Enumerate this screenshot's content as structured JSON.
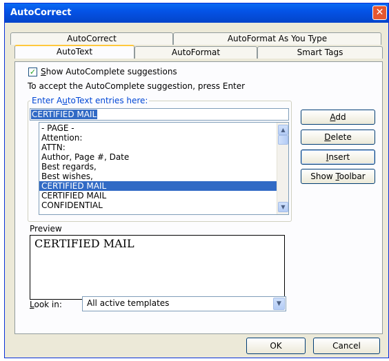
{
  "window": {
    "title": "AutoCorrect",
    "close_glyph": "✕"
  },
  "tabs_back": [
    {
      "label": "AutoCorrect"
    },
    {
      "label": "AutoFormat As You Type"
    }
  ],
  "tabs_front": [
    {
      "label": "AutoText",
      "active": true
    },
    {
      "label": "AutoFormat"
    },
    {
      "label": "Smart Tags"
    }
  ],
  "autotext": {
    "show_suggestions": {
      "pre": "",
      "accel": "S",
      "post": "how AutoComplete suggestions",
      "checked": true
    },
    "instruction": "To accept the AutoComplete suggestion, press Enter",
    "entries_legend": {
      "pre": "Enter A",
      "accel": "u",
      "post": "toText entries here:"
    },
    "entry_value": "CERTIFIED MAIL",
    "entries": [
      {
        "label": "- PAGE -"
      },
      {
        "label": "Attention:"
      },
      {
        "label": "ATTN:"
      },
      {
        "label": "Author, Page #, Date"
      },
      {
        "label": "Best regards,"
      },
      {
        "label": "Best wishes,"
      },
      {
        "label": "CERTIFIED MAIL",
        "selected": true
      },
      {
        "label": "CERTIFIED MAIL"
      },
      {
        "label": "CONFIDENTIAL"
      }
    ],
    "preview_label": "Preview",
    "preview_text": "CERTIFIED MAIL",
    "look_in": {
      "pre": "",
      "accel": "L",
      "post": "ook in:",
      "value": "All active templates"
    }
  },
  "buttons": {
    "add": {
      "pre": "",
      "accel": "A",
      "post": "dd"
    },
    "delete": {
      "pre": "",
      "accel": "D",
      "post": "elete"
    },
    "insert": {
      "pre": "",
      "accel": "I",
      "post": "nsert"
    },
    "show_toolbar": {
      "pre": "Show ",
      "accel": "T",
      "post": "oolbar"
    },
    "ok": "OK",
    "cancel": "Cancel"
  },
  "icons": {
    "check": "✓",
    "scroll_up": "▲",
    "scroll_down": "▼",
    "dropdown": "▼"
  },
  "colors": {
    "title_bar": "#0453e6",
    "selection": "#316ac5",
    "active_tab_accent": "#ffc83c",
    "close_button": "#e5572f"
  }
}
